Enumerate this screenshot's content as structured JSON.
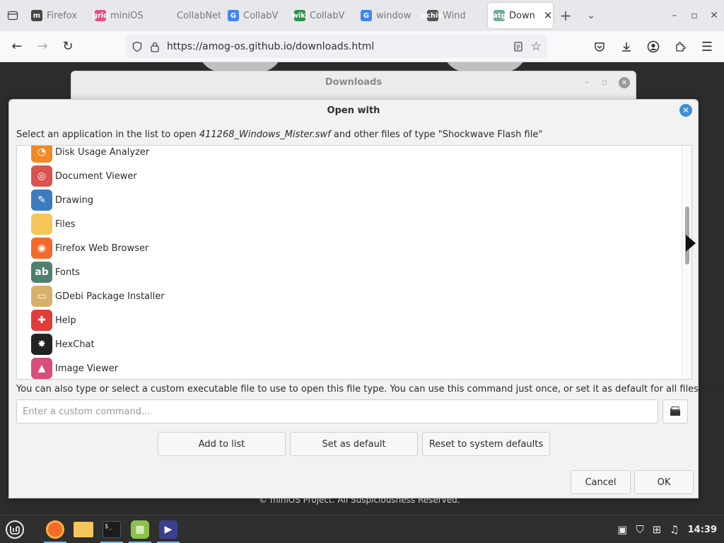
{
  "browser": {
    "tabs": [
      {
        "title": "Firefox",
        "favicon": "m",
        "color": "#444444"
      },
      {
        "title": "miniOS",
        "favicon": "grid",
        "color": "#e64d8b"
      },
      {
        "title": "CollabNet",
        "favicon": "",
        "color": "#e7e7ec"
      },
      {
        "title": "CollabV",
        "favicon": "G",
        "color": "#4285f4"
      },
      {
        "title": "CollabV",
        "favicon": "wiki",
        "color": "#2f8f4f"
      },
      {
        "title": "window",
        "favicon": "G",
        "color": "#4285f4"
      },
      {
        "title": "Wind",
        "favicon": "archive",
        "color": "#555555"
      },
      {
        "title": "Down",
        "favicon": "chatgpt",
        "color": "#74aa9c",
        "active": true
      }
    ],
    "url": "https://amog-os.github.io/downloads.html"
  },
  "page": {
    "footer": "© miniOS Project. All Suspiciousness Reserved."
  },
  "downloads_window": {
    "title": "Downloads"
  },
  "dialog": {
    "title": "Open with",
    "prompt_before": "Select an application in the list to open ",
    "filename": "411268_Windows_Mister.swf",
    "prompt_after": " and other files of type \"Shockwave Flash file\"",
    "apps": [
      {
        "name": "Disk Usage Analyzer",
        "icon": "disk-usage-icon",
        "color": "#f08a24",
        "glyph": "◔"
      },
      {
        "name": "Document Viewer",
        "icon": "document-viewer-icon",
        "color": "#d9534f",
        "glyph": "◎"
      },
      {
        "name": "Drawing",
        "icon": "drawing-icon",
        "color": "#3d7bbf",
        "glyph": "✎"
      },
      {
        "name": "Files",
        "icon": "folder-icon",
        "color": "#f5c65a",
        "glyph": ""
      },
      {
        "name": "Firefox Web Browser",
        "icon": "firefox-icon",
        "color": "#f36a2b",
        "glyph": "◉"
      },
      {
        "name": "Fonts",
        "icon": "fonts-icon",
        "color": "#4f7f6e",
        "glyph": "ab"
      },
      {
        "name": "GDebi Package Installer",
        "icon": "package-icon",
        "color": "#d9b06b",
        "glyph": "▭"
      },
      {
        "name": "Help",
        "icon": "help-icon",
        "color": "#e03c3c",
        "glyph": "✚"
      },
      {
        "name": "HexChat",
        "icon": "hexchat-icon",
        "color": "#222222",
        "glyph": "✸"
      },
      {
        "name": "Image Viewer",
        "icon": "image-viewer-icon",
        "color": "#d84d7a",
        "glyph": "▲"
      }
    ],
    "hint": "You can also type or select a custom executable file to use to open this file type.  You can use this command just once, or set it as default for all files of this type.",
    "command_placeholder": "Enter a custom command...",
    "buttons": {
      "add_to_list": "Add to list",
      "set_as_default": "Set as default",
      "reset": "Reset to system defaults",
      "cancel": "Cancel",
      "ok": "OK"
    }
  },
  "taskbar": {
    "clock": "14:39"
  }
}
